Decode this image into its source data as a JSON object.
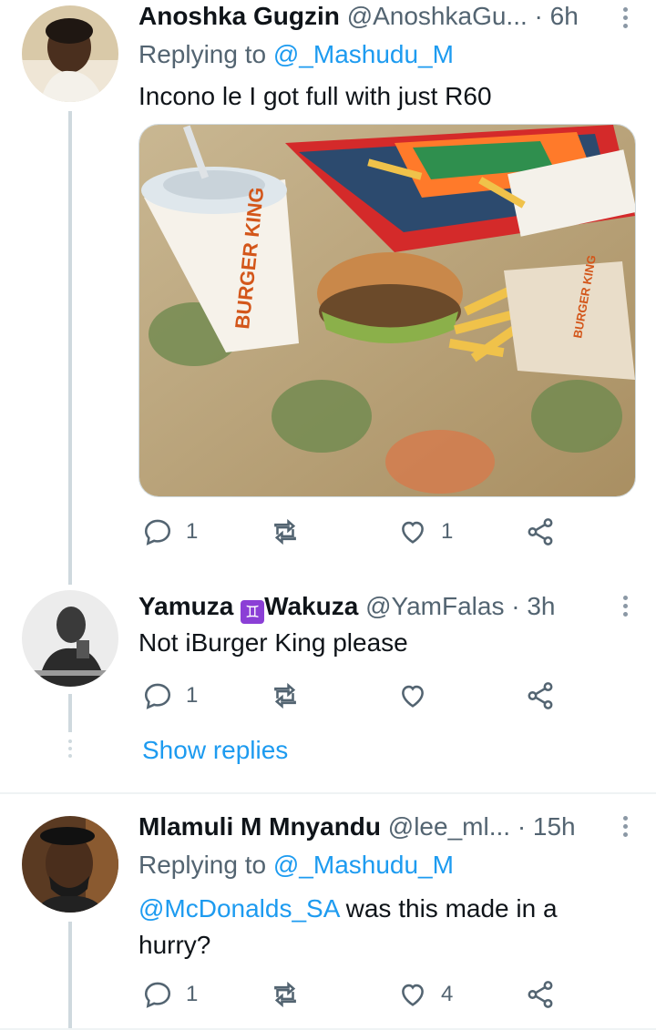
{
  "tweets": [
    {
      "name": "Anoshka Gugzin",
      "handle": "@AnoshkaGu...",
      "time": "· 6h",
      "replying_label": "Replying to",
      "replying_handle": "@_Mashudu_M",
      "text": "Incono le I got full with just R60",
      "image_brand_cup": "BURGER KING",
      "image_brand_bag": "BURGER KING",
      "replies": "1",
      "retweets": "",
      "likes": "1"
    },
    {
      "name": "Yamuza",
      "name_emoji": "♊",
      "name_suffix": "Wakuza",
      "handle": "@YamFalas",
      "time": "· 3h",
      "text": "Not iBurger King please",
      "replies": "1",
      "retweets": "",
      "likes": "",
      "show_replies": "Show replies"
    },
    {
      "name": "Mlamuli M Mnyandu",
      "handle": "@lee_ml...",
      "time": "· 15h",
      "replying_label": "Replying to",
      "replying_handle": "@_Mashudu_M",
      "mention": "@McDonalds_SA",
      "text_rest": " was this made in a hurry?",
      "replies": "1",
      "retweets": "",
      "likes": "4"
    }
  ],
  "icons": {
    "reply": "reply-icon",
    "retweet": "retweet-icon",
    "like": "heart-icon",
    "share": "share-icon",
    "more": "more-icon"
  },
  "colors": {
    "link": "#1d9bf0",
    "muted": "#536471",
    "thread_line": "#cfd9de"
  }
}
